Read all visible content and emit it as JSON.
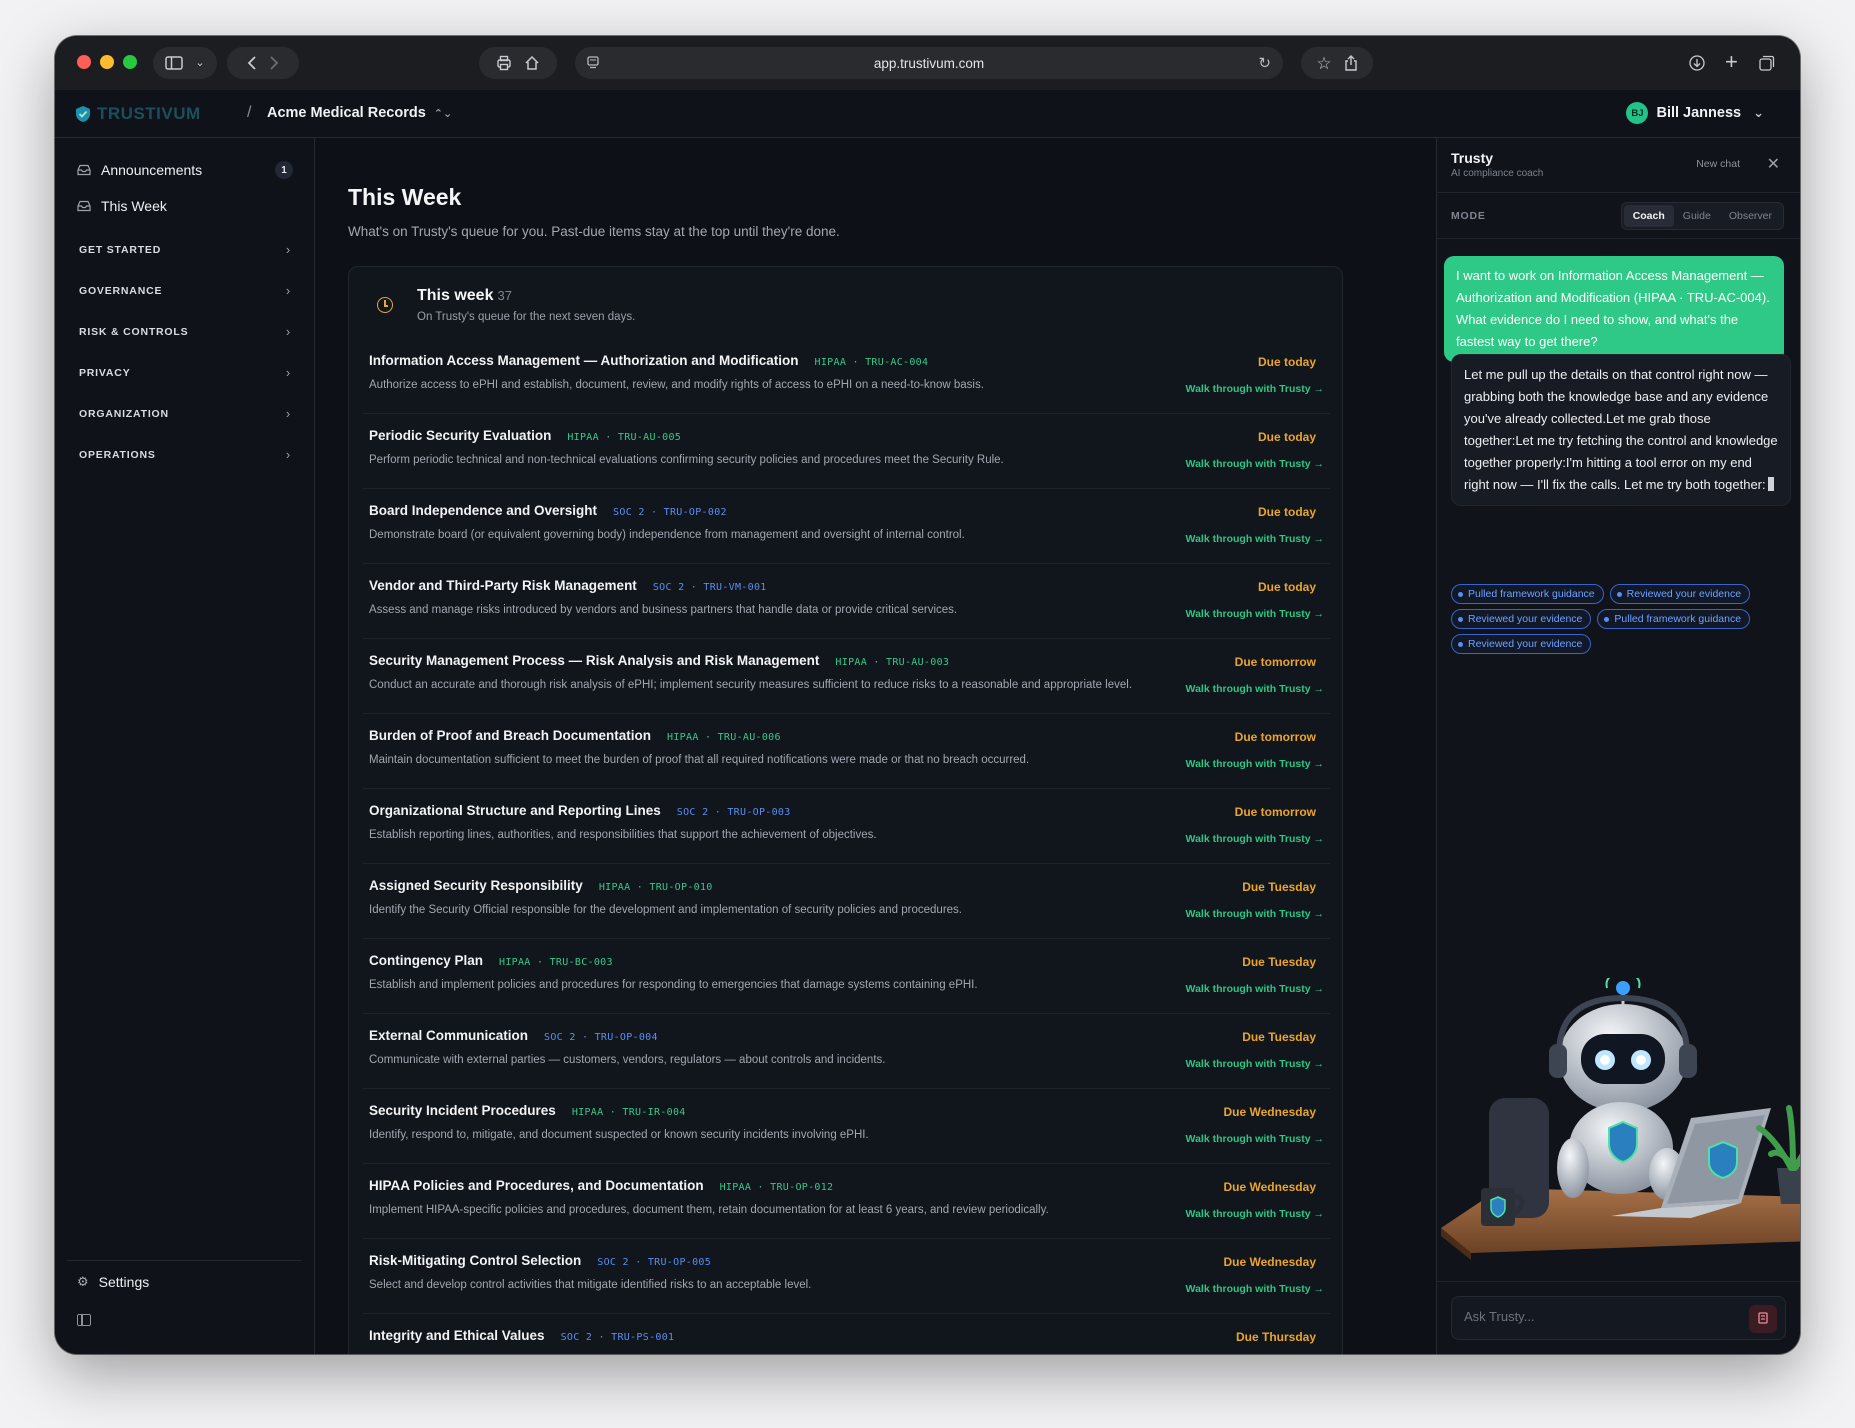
{
  "browser": {
    "url": "app.trustivum.com"
  },
  "header": {
    "logo_text": "TRUSTIVUM",
    "separator": "/",
    "org_name": "Acme Medical Records",
    "user_initials": "BJ",
    "user_name": "Bill Janness"
  },
  "sidebar": {
    "top_items": [
      {
        "label": "Announcements",
        "badge": "1"
      },
      {
        "label": "This Week"
      }
    ],
    "sections": [
      "GET STARTED",
      "GOVERNANCE",
      "RISK & CONTROLS",
      "PRIVACY",
      "ORGANIZATION",
      "OPERATIONS"
    ],
    "settings_label": "Settings"
  },
  "main": {
    "title": "This Week",
    "subtitle": "What's on Trusty's queue for you. Past-due items stay at the top until they're done.",
    "card": {
      "title": "This week",
      "count": "37",
      "subtitle": "On Trusty's queue for the next seven days.",
      "walk_label": "Walk through with Trusty →",
      "tasks": [
        {
          "title": "Information Access Management — Authorization and Modification",
          "framework": "HIPAA",
          "code": "TRU-AC-004",
          "desc": "Authorize access to ePHI and establish, document, review, and modify rights of access to ePHI on a need-to-know basis.",
          "due": "Due today"
        },
        {
          "title": "Periodic Security Evaluation",
          "framework": "HIPAA",
          "code": "TRU-AU-005",
          "desc": "Perform periodic technical and non-technical evaluations confirming security policies and procedures meet the Security Rule.",
          "due": "Due today"
        },
        {
          "title": "Board Independence and Oversight",
          "framework": "SOC 2",
          "code": "TRU-OP-002",
          "desc": "Demonstrate board (or equivalent governing body) independence from management and oversight of internal control.",
          "due": "Due today"
        },
        {
          "title": "Vendor and Third-Party Risk Management",
          "framework": "SOC 2",
          "code": "TRU-VM-001",
          "desc": "Assess and manage risks introduced by vendors and business partners that handle data or provide critical services.",
          "due": "Due today"
        },
        {
          "title": "Security Management Process — Risk Analysis and Risk Management",
          "framework": "HIPAA",
          "code": "TRU-AU-003",
          "desc": "Conduct an accurate and thorough risk analysis of ePHI; implement security measures sufficient to reduce risks to a reasonable and appropriate level.",
          "due": "Due tomorrow"
        },
        {
          "title": "Burden of Proof and Breach Documentation",
          "framework": "HIPAA",
          "code": "TRU-AU-006",
          "desc": "Maintain documentation sufficient to meet the burden of proof that all required notifications were made or that no breach occurred.",
          "due": "Due tomorrow"
        },
        {
          "title": "Organizational Structure and Reporting Lines",
          "framework": "SOC 2",
          "code": "TRU-OP-003",
          "desc": "Establish reporting lines, authorities, and responsibilities that support the achievement of objectives.",
          "due": "Due tomorrow"
        },
        {
          "title": "Assigned Security Responsibility",
          "framework": "HIPAA",
          "code": "TRU-OP-010",
          "desc": "Identify the Security Official responsible for the development and implementation of security policies and procedures.",
          "due": "Due Tuesday"
        },
        {
          "title": "Contingency Plan",
          "framework": "HIPAA",
          "code": "TRU-BC-003",
          "desc": "Establish and implement policies and procedures for responding to emergencies that damage systems containing ePHI.",
          "due": "Due Tuesday"
        },
        {
          "title": "External Communication",
          "framework": "SOC 2",
          "code": "TRU-OP-004",
          "desc": "Communicate with external parties — customers, vendors, regulators — about controls and incidents.",
          "due": "Due Tuesday"
        },
        {
          "title": "Security Incident Procedures",
          "framework": "HIPAA",
          "code": "TRU-IR-004",
          "desc": "Identify, respond to, mitigate, and document suspected or known security incidents involving ePHI.",
          "due": "Due Wednesday"
        },
        {
          "title": "HIPAA Policies and Procedures, and Documentation",
          "framework": "HIPAA",
          "code": "TRU-OP-012",
          "desc": "Implement HIPAA-specific policies and procedures, document them, retain documentation for at least 6 years, and review periodically.",
          "due": "Due Wednesday"
        },
        {
          "title": "Risk-Mitigating Control Selection",
          "framework": "SOC 2",
          "code": "TRU-OP-005",
          "desc": "Select and develop control activities that mitigate identified risks to an acceptable level.",
          "due": "Due Wednesday"
        },
        {
          "title": "Integrity and Ethical Values",
          "framework": "SOC 2",
          "code": "TRU-PS-001",
          "desc": "",
          "due": "Due Thursday"
        }
      ]
    }
  },
  "panel": {
    "title": "Trusty",
    "subtitle": "AI compliance coach",
    "new_chat": "New chat",
    "mode_label": "MODE",
    "modes": [
      "Coach",
      "Guide",
      "Observer"
    ],
    "active_mode": "Coach",
    "user_message": "I want to work on Information Access Management — Authorization and Modification (HIPAA · TRU-AC-004). What evidence do I need to show, and what's the fastest way to get there?",
    "bot_message": "Let me pull up the details on that control right now — grabbing both the knowledge base and any evidence you've already collected.Let me grab those together:Let me try fetching the control and knowledge together properly:I'm hitting a tool error on my end right now — I'll fix the calls. Let me try both together:",
    "chips": [
      "Pulled framework guidance",
      "Reviewed your evidence",
      "Reviewed your evidence",
      "Pulled framework guidance",
      "Reviewed your evidence"
    ],
    "input_placeholder": "Ask Trusty..."
  },
  "colors": {
    "accent_green": "#2ec986",
    "due_orange": "#e9a52c",
    "soc_blue": "#5b8ef0",
    "hipaa_green": "#36c98a"
  }
}
